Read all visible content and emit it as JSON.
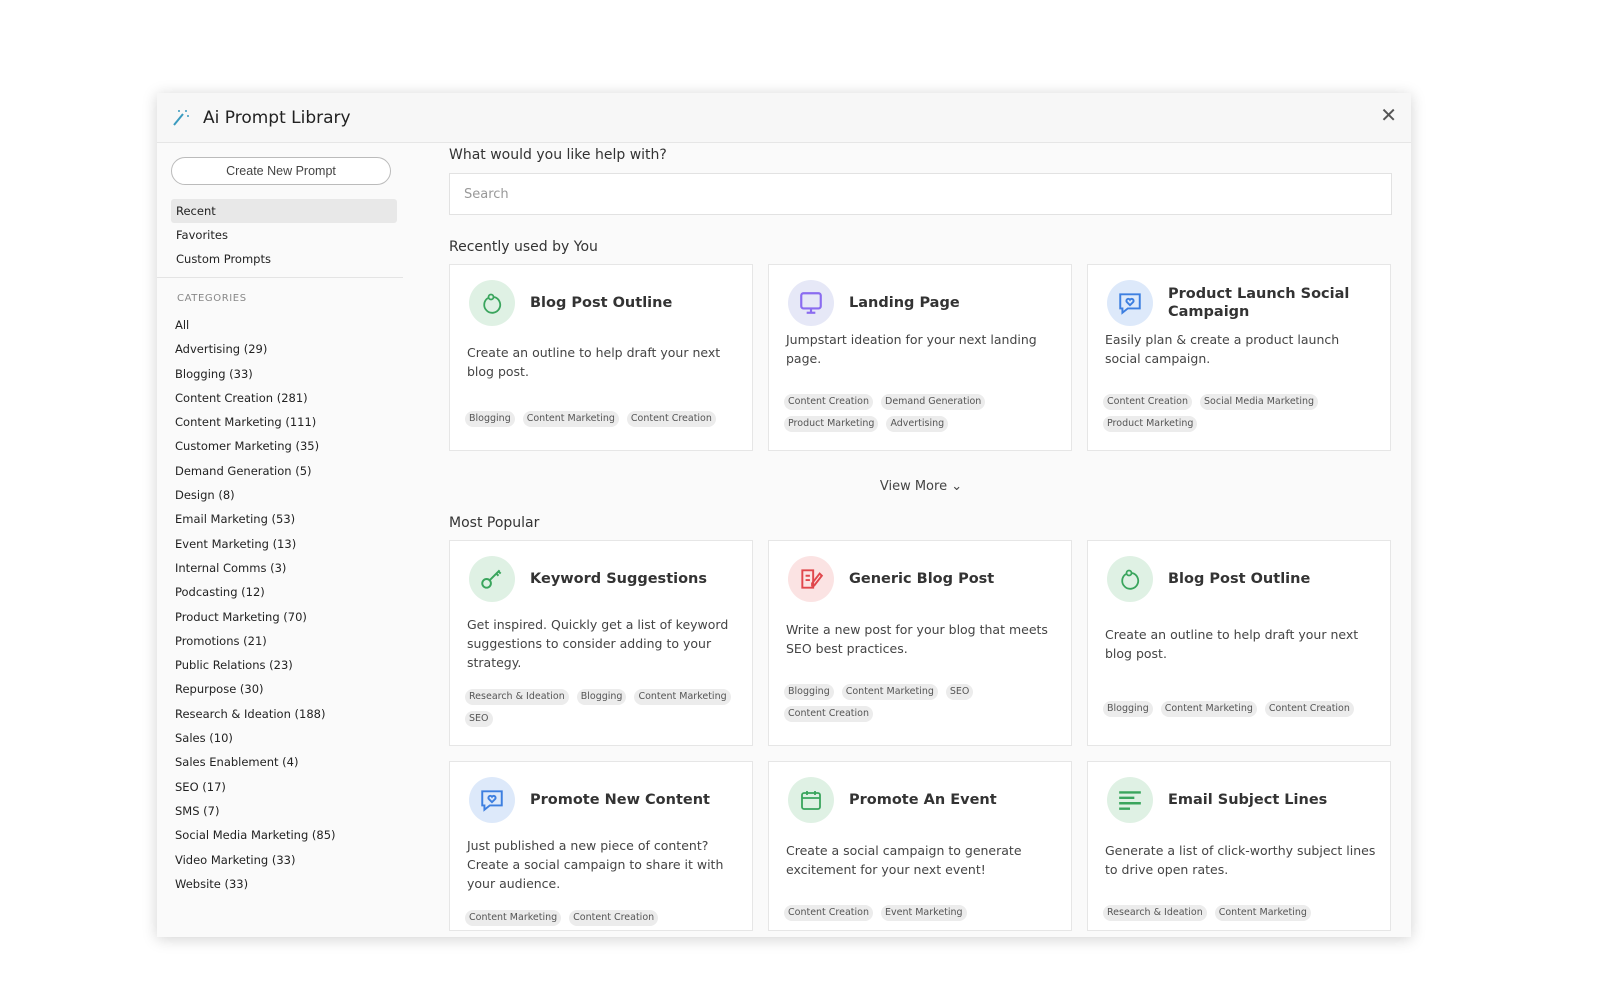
{
  "modal": {
    "title": "Ai Prompt Library",
    "close_icon": "close-icon",
    "wand_icon": "magic-wand-icon"
  },
  "sidebar": {
    "create_label": "Create New Prompt",
    "nav": [
      {
        "label": "Recent",
        "active": true
      },
      {
        "label": "Favorites"
      },
      {
        "label": "Custom Prompts"
      }
    ],
    "categories_heading": "CATEGORIES",
    "categories": [
      "All",
      "Advertising (29)",
      "Blogging (33)",
      "Content Creation (281)",
      "Content Marketing (111)",
      "Customer Marketing (35)",
      "Demand Generation (5)",
      "Design (8)",
      "Email Marketing (53)",
      "Event Marketing (13)",
      "Internal Comms (3)",
      "Podcasting (12)",
      "Product Marketing (70)",
      "Promotions (21)",
      "Public Relations (23)",
      "Repurpose (30)",
      "Research & Ideation (188)",
      "Sales (10)",
      "Sales Enablement (4)",
      "SEO (17)",
      "SMS (7)",
      "Social Media Marketing (85)",
      "Video Marketing (33)",
      "Website (33)"
    ]
  },
  "main": {
    "question": "What would you like help with?",
    "search_placeholder": "Search",
    "recent_heading": "Recently used by You",
    "view_more": "View More",
    "popular_heading": "Most Popular",
    "recent": [
      {
        "title": "Blog Post Outline",
        "icon": "outline-loop-icon",
        "color": "#3aa55d",
        "bg": "#dff1e4",
        "desc": "Create an outline to help draft your next blog post.",
        "tags": [
          "Blogging",
          "Content Marketing",
          "Content Creation"
        ]
      },
      {
        "title": "Landing Page",
        "icon": "monitor-icon",
        "color": "#8a6cf0",
        "bg": "#e6e8f7",
        "desc": "Jumpstart ideation for your next landing page.",
        "tags": [
          "Content Creation",
          "Demand Generation",
          "Product Marketing",
          "Advertising"
        ]
      },
      {
        "title": "Product Launch Social Campaign",
        "icon": "chat-heart-icon",
        "color": "#3d7fe0",
        "bg": "#dde9fa",
        "desc": "Easily plan & create a product launch social campaign.",
        "tags": [
          "Content Creation",
          "Social Media Marketing",
          "Product Marketing"
        ]
      }
    ],
    "popular": [
      {
        "title": "Keyword Suggestions",
        "icon": "key-icon",
        "color": "#3aa55d",
        "bg": "#dff1e4",
        "desc": "Get inspired. Quickly get a list of keyword suggestions to consider adding to your strategy.",
        "tags": [
          "Research & Ideation",
          "Blogging",
          "Content Marketing",
          "SEO"
        ]
      },
      {
        "title": "Generic Blog Post",
        "icon": "edit-document-icon",
        "color": "#e0474c",
        "bg": "#fbe3e3",
        "desc": "Write a new post for your blog that meets SEO best practices.",
        "tags": [
          "Blogging",
          "Content Marketing",
          "SEO",
          "Content Creation"
        ]
      },
      {
        "title": "Blog Post Outline",
        "icon": "outline-loop-icon",
        "color": "#3aa55d",
        "bg": "#dff1e4",
        "desc": "Create an outline to help draft your next blog post.",
        "tags": [
          "Blogging",
          "Content Marketing",
          "Content Creation"
        ]
      },
      {
        "title": "Promote New Content",
        "icon": "chat-heart-icon",
        "color": "#3d7fe0",
        "bg": "#dde9fa",
        "desc": "Just published a new piece of content? Create a social campaign to share it with your audience.",
        "tags": [
          "Content Marketing",
          "Content Creation"
        ]
      },
      {
        "title": "Promote An Event",
        "icon": "calendar-icon",
        "color": "#3aa55d",
        "bg": "#dff1e4",
        "desc": "Create a social campaign to generate excitement for your next event!",
        "tags": [
          "Content Creation",
          "Event Marketing"
        ]
      },
      {
        "title": "Email Subject Lines",
        "icon": "lines-icon",
        "color": "#3aa55d",
        "bg": "#dff1e4",
        "desc": "Generate a list of click-worthy subject lines to drive open rates.",
        "tags": [
          "Research & Ideation",
          "Content Marketing"
        ]
      }
    ]
  }
}
